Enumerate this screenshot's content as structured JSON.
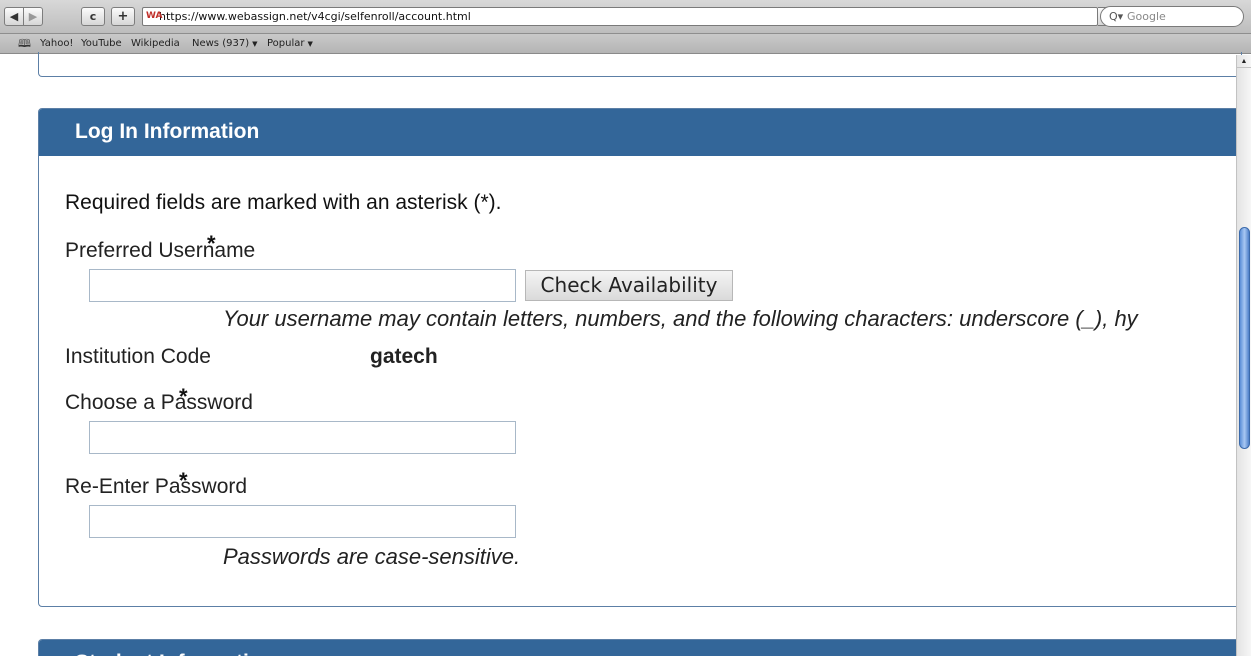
{
  "browser": {
    "back_glyph": "◀",
    "forward_glyph": "▶",
    "reload_glyph": "c",
    "add_glyph": "+",
    "url": "https://www.webassign.net/v4cgi/selfenroll/account.html",
    "site_icon": "WA",
    "search_placeholder": "Google",
    "bookmarks": [
      {
        "label": "Yahoo!"
      },
      {
        "label": "YouTube"
      },
      {
        "label": "Wikipedia"
      },
      {
        "label": "News (937)",
        "menu": true
      },
      {
        "label": "Popular",
        "menu": true
      }
    ]
  },
  "login_section": {
    "title": "Log In Information",
    "required_note": "Required fields are marked with an asterisk (*).",
    "required_marker": "*",
    "username": {
      "label": "Preferred Username",
      "value": "",
      "check_button": "Check Availability",
      "hint": "Your username may contain letters, numbers, and the following characters: underscore (_), hy"
    },
    "institution": {
      "label": "Institution Code",
      "value": "gatech"
    },
    "password": {
      "label": "Choose a Password",
      "value": ""
    },
    "password_confirm": {
      "label": "Re-Enter Password",
      "value": "",
      "hint": "Passwords are case-sensitive."
    }
  },
  "student_section": {
    "title": "Student Information"
  }
}
